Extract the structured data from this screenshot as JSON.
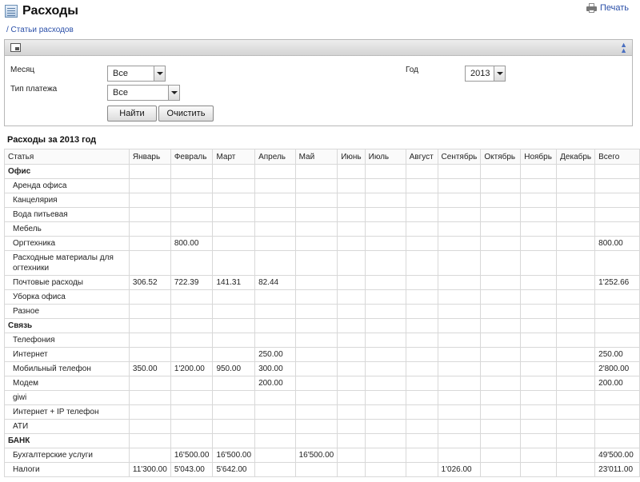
{
  "header": {
    "title": "Расходы",
    "print_label": "Печать"
  },
  "breadcrumb": "/ Статьи расходов",
  "filter": {
    "month_label": "Месяц",
    "month_value": "Все",
    "payment_type_label": "Тип платежа",
    "payment_type_value": "Все",
    "year_label": "Год",
    "year_value": "2013",
    "find_button": "Найти",
    "clear_button": "Очистить"
  },
  "report": {
    "title": "Расходы за 2013 год",
    "columns": [
      "Статья",
      "Январь",
      "Февраль",
      "Март",
      "Апрель",
      "Май",
      "Июнь",
      "Июль",
      "Август",
      "Сентябрь",
      "Октябрь",
      "Ноябрь",
      "Декабрь",
      "Всего"
    ],
    "rows": [
      {
        "group": true,
        "cells": [
          "Офис",
          "",
          "",
          "",
          "",
          "",
          "",
          "",
          "",
          "",
          "",
          "",
          "",
          ""
        ]
      },
      {
        "cells": [
          "Аренда офиса",
          "",
          "",
          "",
          "",
          "",
          "",
          "",
          "",
          "",
          "",
          "",
          "",
          ""
        ]
      },
      {
        "cells": [
          "Канцелярия",
          "",
          "",
          "",
          "",
          "",
          "",
          "",
          "",
          "",
          "",
          "",
          "",
          ""
        ]
      },
      {
        "cells": [
          "Вода питьевая",
          "",
          "",
          "",
          "",
          "",
          "",
          "",
          "",
          "",
          "",
          "",
          "",
          ""
        ]
      },
      {
        "cells": [
          "Мебель",
          "",
          "",
          "",
          "",
          "",
          "",
          "",
          "",
          "",
          "",
          "",
          "",
          ""
        ]
      },
      {
        "cells": [
          "Оргтехника",
          "",
          "800.00",
          "",
          "",
          "",
          "",
          "",
          "",
          "",
          "",
          "",
          "",
          "800.00"
        ]
      },
      {
        "tall": true,
        "cells": [
          "Расходные материалы для огтехники",
          "",
          "",
          "",
          "",
          "",
          "",
          "",
          "",
          "",
          "",
          "",
          "",
          ""
        ]
      },
      {
        "cells": [
          "Почтовые расходы",
          "306.52",
          "722.39",
          "141.31",
          "82.44",
          "",
          "",
          "",
          "",
          "",
          "",
          "",
          "",
          "1'252.66"
        ]
      },
      {
        "cells": [
          "Уборка офиса",
          "",
          "",
          "",
          "",
          "",
          "",
          "",
          "",
          "",
          "",
          "",
          "",
          ""
        ]
      },
      {
        "cells": [
          "Разное",
          "",
          "",
          "",
          "",
          "",
          "",
          "",
          "",
          "",
          "",
          "",
          "",
          ""
        ]
      },
      {
        "group": true,
        "cells": [
          "Связь",
          "",
          "",
          "",
          "",
          "",
          "",
          "",
          "",
          "",
          "",
          "",
          "",
          ""
        ]
      },
      {
        "cells": [
          "Телефония",
          "",
          "",
          "",
          "",
          "",
          "",
          "",
          "",
          "",
          "",
          "",
          "",
          ""
        ]
      },
      {
        "cells": [
          "Интернет",
          "",
          "",
          "",
          "250.00",
          "",
          "",
          "",
          "",
          "",
          "",
          "",
          "",
          "250.00"
        ]
      },
      {
        "cells": [
          "Мобильный телефон",
          "350.00",
          "1'200.00",
          "950.00",
          "300.00",
          "",
          "",
          "",
          "",
          "",
          "",
          "",
          "",
          "2'800.00"
        ]
      },
      {
        "cells": [
          "Модем",
          "",
          "",
          "",
          "200.00",
          "",
          "",
          "",
          "",
          "",
          "",
          "",
          "",
          "200.00"
        ]
      },
      {
        "cells": [
          "giwi",
          "",
          "",
          "",
          "",
          "",
          "",
          "",
          "",
          "",
          "",
          "",
          "",
          ""
        ]
      },
      {
        "cells": [
          "Интернет + IP телефон",
          "",
          "",
          "",
          "",
          "",
          "",
          "",
          "",
          "",
          "",
          "",
          "",
          ""
        ]
      },
      {
        "cells": [
          "АТИ",
          "",
          "",
          "",
          "",
          "",
          "",
          "",
          "",
          "",
          "",
          "",
          "",
          ""
        ]
      },
      {
        "group": true,
        "cells": [
          "БАНК",
          "",
          "",
          "",
          "",
          "",
          "",
          "",
          "",
          "",
          "",
          "",
          "",
          ""
        ]
      },
      {
        "cells": [
          "Бухгалтерские услуги",
          "",
          "16'500.00",
          "16'500.00",
          "",
          "16'500.00",
          "",
          "",
          "",
          "",
          "",
          "",
          "",
          "49'500.00"
        ]
      },
      {
        "cells": [
          "Налоги",
          "11'300.00",
          "5'043.00",
          "5'642.00",
          "",
          "",
          "",
          "",
          "",
          "1'026.00",
          "",
          "",
          "",
          "23'011.00"
        ]
      }
    ]
  }
}
